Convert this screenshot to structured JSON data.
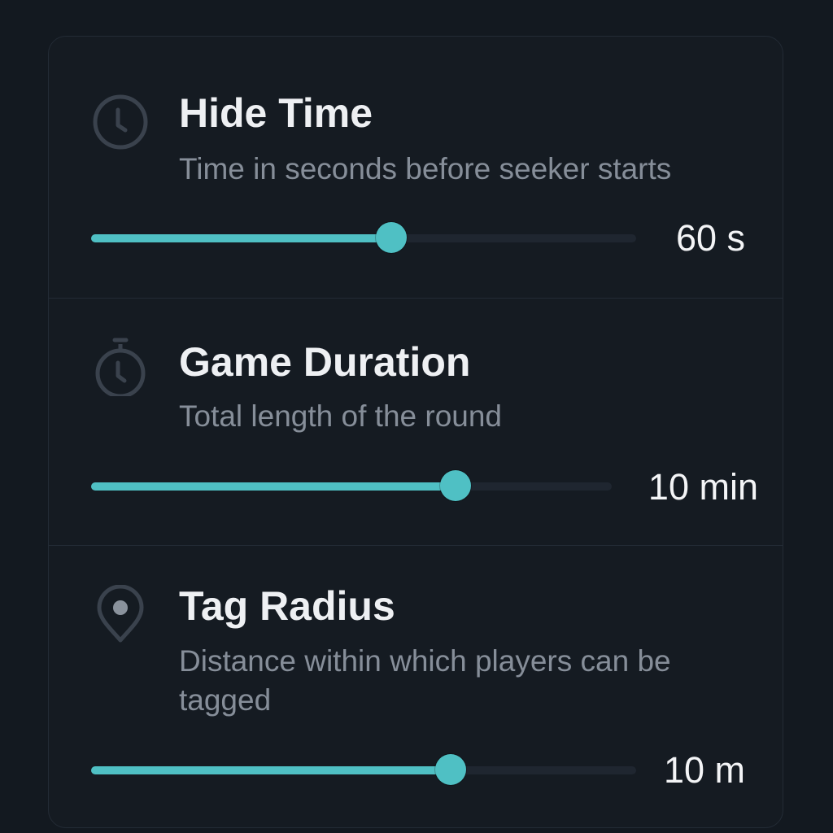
{
  "accent_color": "#4fc0c4",
  "settings": [
    {
      "title": "Hide Time",
      "description": "Time in seconds before seeker starts",
      "icon": "clock-icon",
      "value_label": "60 s",
      "level": 0.55
    },
    {
      "title": "Game Duration",
      "description": "Total length of the round",
      "icon": "stopwatch-icon",
      "value_label": "10 min",
      "level": 0.7
    },
    {
      "title": "Tag Radius",
      "description": "Distance within which players can be tagged",
      "icon": "location-pin-icon",
      "value_label": "10 m",
      "level": 0.66
    }
  ]
}
